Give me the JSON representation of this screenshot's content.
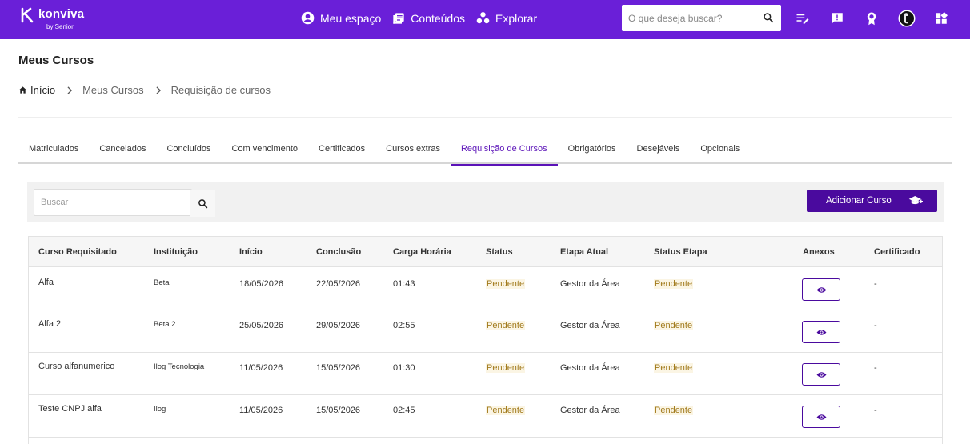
{
  "brand": {
    "name": "konviva",
    "sub": "by Senior"
  },
  "nav": [
    {
      "label": "Meu espaço",
      "icon": "account-circle-icon"
    },
    {
      "label": "Conteúdos",
      "icon": "library-icon"
    },
    {
      "label": "Explorar",
      "icon": "explore-icon"
    }
  ],
  "search": {
    "placeholder": "O que deseja buscar?"
  },
  "toolbar_icons": [
    "playlist-edit-icon",
    "feedback-icon",
    "badge-icon",
    "avatar",
    "apps-icon"
  ],
  "page": {
    "title": "Meus Cursos"
  },
  "breadcrumb": {
    "home": "Início",
    "items": [
      "Meus Cursos",
      "Requisição de cursos"
    ]
  },
  "tabs": [
    {
      "label": "Matriculados"
    },
    {
      "label": "Cancelados"
    },
    {
      "label": "Concluídos"
    },
    {
      "label": "Com vencimento"
    },
    {
      "label": "Certificados"
    },
    {
      "label": "Cursos extras"
    },
    {
      "label": "Requisição de Cursos",
      "active": true
    },
    {
      "label": "Obrigatórios"
    },
    {
      "label": "Desejáveis"
    },
    {
      "label": "Opcionais"
    }
  ],
  "filter": {
    "search_placeholder": "Buscar",
    "add_button": "Adicionar Curso"
  },
  "table": {
    "columns": [
      "Curso Requisitado",
      "Instituição",
      "Início",
      "Conclusão",
      "Carga Horária",
      "Status",
      "Etapa Atual",
      "Status Etapa",
      "Anexos",
      "Certificado"
    ],
    "rows": [
      {
        "curso": "Alfa",
        "instituicao": "Beta",
        "inicio": "18/05/2026",
        "conclusao": "22/05/2026",
        "carga": "01:43",
        "status": "Pendente",
        "etapa": "Gestor da Área",
        "status_etapa": "Pendente",
        "certificado": "-"
      },
      {
        "curso": "Alfa 2",
        "instituicao": "Beta 2",
        "inicio": "25/05/2026",
        "conclusao": "29/05/2026",
        "carga": "02:55",
        "status": "Pendente",
        "etapa": "Gestor da Área",
        "status_etapa": "Pendente",
        "certificado": "-"
      },
      {
        "curso": "Curso alfanumerico",
        "instituicao": "Ilog Tecnologia",
        "inicio": "11/05/2026",
        "conclusao": "15/05/2026",
        "carga": "01:30",
        "status": "Pendente",
        "etapa": "Gestor da Área",
        "status_etapa": "Pendente",
        "certificado": "-"
      },
      {
        "curso": "Teste CNPJ alfa",
        "instituicao": "Ilog",
        "inicio": "11/05/2026",
        "conclusao": "15/05/2026",
        "carga": "02:45",
        "status": "Pendente",
        "etapa": "Gestor da Área",
        "status_etapa": "Pendente",
        "certificado": "-"
      }
    ]
  },
  "colors": {
    "brand": "#6a1fd8",
    "primary": "#4a0a9e",
    "pending_bg": "#fbf5e4",
    "pending_text": "#a17a1c"
  }
}
